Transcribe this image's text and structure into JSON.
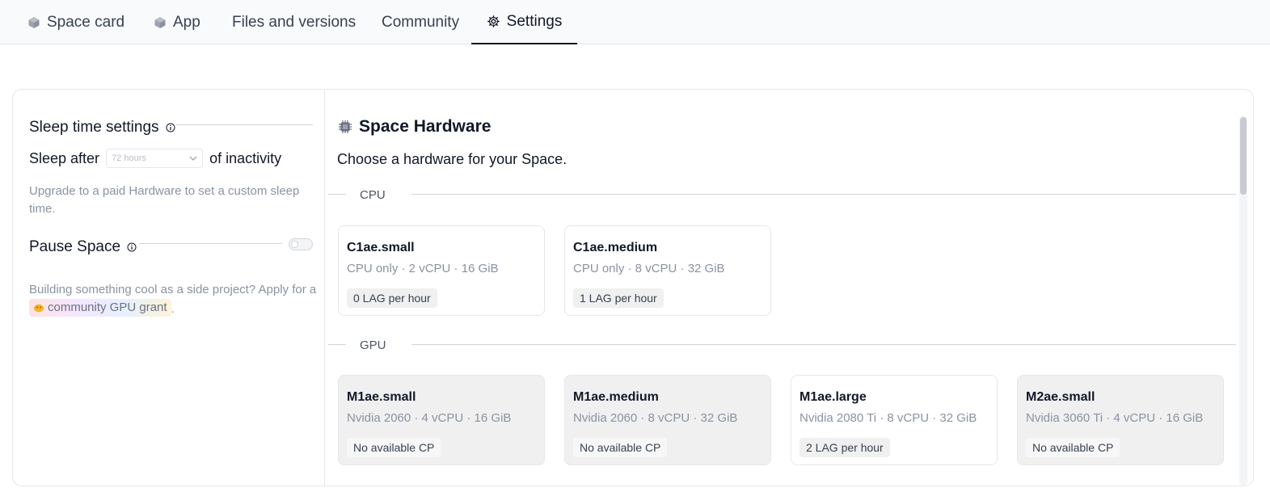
{
  "tabs": [
    {
      "label": "Space card",
      "icon": "cube-icon"
    },
    {
      "label": "App",
      "icon": "cube-icon"
    },
    {
      "label": "Files and versions",
      "icon": ""
    },
    {
      "label": "Community",
      "icon": ""
    },
    {
      "label": "Settings",
      "icon": "gear-icon",
      "active": true
    }
  ],
  "sleep": {
    "title": "Sleep time settings",
    "prefix": "Sleep after",
    "select_value": "72 hours",
    "suffix": "of inactivity",
    "note": "Upgrade to a paid Hardware to set a custom sleep time."
  },
  "pause": {
    "title": "Pause Space",
    "enabled": false
  },
  "grant": {
    "text_before": "Building something cool as a side project? Apply for a",
    "link": "community GPU grant",
    "text_after": "."
  },
  "hardware": {
    "title": "Space Hardware",
    "subtitle": "Choose a hardware for your Space.",
    "groups": [
      {
        "label": "CPU",
        "cards": [
          {
            "name": "C1ae.small",
            "spec": "CPU only · 2 vCPU · 16 GiB",
            "price": "0 LAG per hour",
            "available": true
          },
          {
            "name": "C1ae.medium",
            "spec": "CPU only · 8 vCPU · 32 GiB",
            "price": "1 LAG per hour",
            "available": true
          }
        ]
      },
      {
        "label": "GPU",
        "cards": [
          {
            "name": "M1ae.small",
            "spec": "Nvidia 2060 · 4 vCPU · 16 GiB",
            "price": "No available CP",
            "available": false
          },
          {
            "name": "M1ae.medium",
            "spec": "Nvidia 2060 · 8 vCPU · 32 GiB",
            "price": "No available CP",
            "available": false
          },
          {
            "name": "M1ae.large",
            "spec": "Nvidia 2080 Ti · 8 vCPU · 32 GiB",
            "price": "2 LAG per hour",
            "available": true
          },
          {
            "name": "M2ae.small",
            "spec": "Nvidia 3060 Ti · 4 vCPU · 16 GiB",
            "price": "No available CP",
            "available": false
          }
        ]
      }
    ]
  }
}
